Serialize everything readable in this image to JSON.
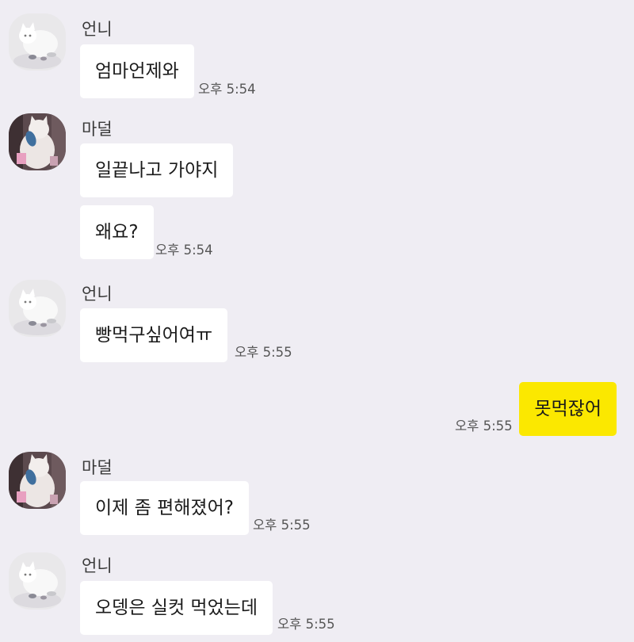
{
  "chat": {
    "messages": [
      {
        "sender": "언니",
        "avatar": "white-cat-avatar",
        "text": "엄마언제와",
        "time": "오후 5:54"
      },
      {
        "sender": "마덜",
        "avatar": "cat-with-toy-avatar",
        "text": "일끝나고 가야지"
      },
      {
        "text": "왜요?",
        "time": "오후 5:54"
      },
      {
        "sender": "언니",
        "avatar": "white-cat-avatar",
        "text": "빵먹구싶어여ㅠ",
        "time": "오후 5:55"
      },
      {
        "mine": true,
        "text": "못먹잖어",
        "time": "오후 5:55"
      },
      {
        "sender": "마덜",
        "avatar": "cat-with-toy-avatar",
        "text": "이제 좀 편해졌어?",
        "time": "오후 5:55"
      },
      {
        "sender": "언니",
        "avatar": "white-cat-avatar",
        "text": "오뎅은 실컷 먹었는데",
        "time": "오후 5:55"
      }
    ]
  },
  "colors": {
    "background": "#efedf3",
    "incoming_bubble": "#ffffff",
    "outgoing_bubble": "#fbe800"
  }
}
